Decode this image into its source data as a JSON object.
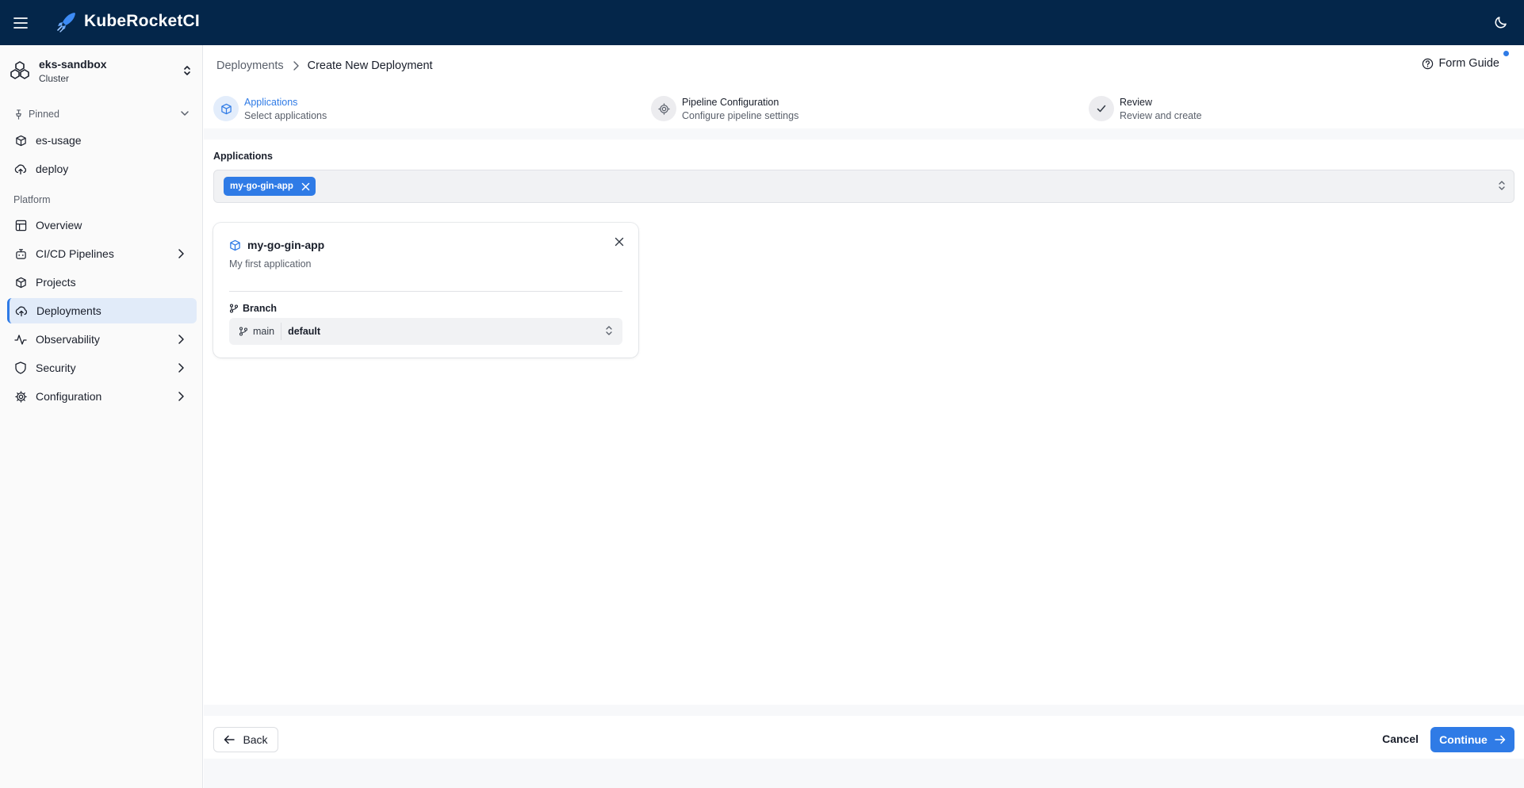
{
  "topbar": {
    "brand": "KubeRocketCI",
    "brand_color": "#04264a",
    "icons": [
      "menu-icon",
      "rocket-logo-icon",
      "moon-icon"
    ]
  },
  "sidebar": {
    "cluster": {
      "name": "eks-sandbox",
      "type": "Cluster"
    },
    "pinned_label": "Pinned",
    "pinned": [
      {
        "label": "es-usage",
        "icon": "box-icon"
      },
      {
        "label": "deploy",
        "icon": "cloud-upload-icon"
      }
    ],
    "platform_label": "Platform",
    "items": [
      {
        "label": "Overview",
        "icon": "layout-icon",
        "has_arrow": false
      },
      {
        "label": "CI/CD Pipelines",
        "icon": "bot-icon",
        "has_arrow": true
      },
      {
        "label": "Projects",
        "icon": "box-icon",
        "has_arrow": false
      },
      {
        "label": "Deployments",
        "icon": "cloud-upload-icon",
        "has_arrow": false,
        "active": true
      },
      {
        "label": "Observability",
        "icon": "activity-icon",
        "has_arrow": true
      },
      {
        "label": "Security",
        "icon": "shield-icon",
        "has_arrow": true
      },
      {
        "label": "Configuration",
        "icon": "gear-icon",
        "has_arrow": true
      }
    ]
  },
  "breadcrumb": {
    "parent": "Deployments",
    "current": "Create New Deployment"
  },
  "form_guide": "Form Guide",
  "steps": [
    {
      "title": "Applications",
      "subtitle": "Select applications",
      "active": true
    },
    {
      "title": "Pipeline Configuration",
      "subtitle": "Configure pipeline settings",
      "active": false
    },
    {
      "title": "Review",
      "subtitle": "Review and create",
      "active": false
    }
  ],
  "applications": {
    "label": "Applications",
    "selected": [
      "my-go-gin-app"
    ]
  },
  "app_card": {
    "title": "my-go-gin-app",
    "description": "My first application",
    "branch_label": "Branch",
    "branch_name": "main",
    "branch_value": "default"
  },
  "footer": {
    "back": "Back",
    "cancel": "Cancel",
    "continue": "Continue"
  },
  "colors": {
    "accent": "#2f7be6",
    "active_bg": "#e1ebf9"
  }
}
